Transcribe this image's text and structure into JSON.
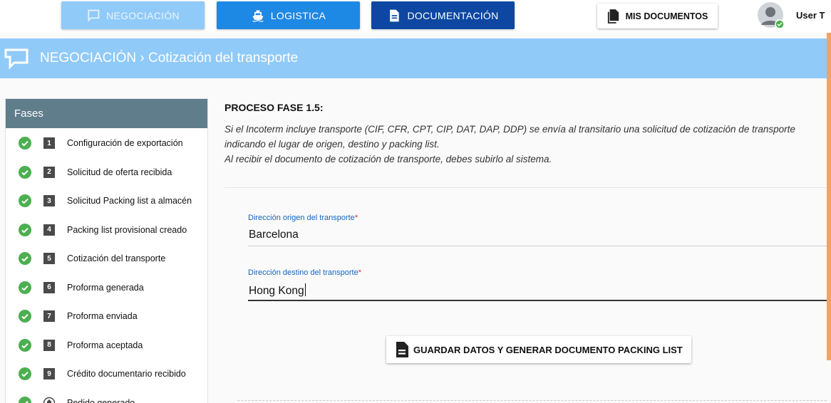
{
  "nav": {
    "negociacion": "NEGOCIACIÓN",
    "logistica": "LOGISTICA",
    "documentacion": "DOCUMENTACIÓN",
    "mis_documentos": "MIS DOCUMENTOS",
    "user": "User T"
  },
  "header": {
    "title": "NEGOCIACIÓN › Cotización del transporte"
  },
  "sidebar": {
    "title": "Fases",
    "phases": [
      {
        "num": "1",
        "label": "Configuración de exportación"
      },
      {
        "num": "2",
        "label": "Solicitud de oferta recibida"
      },
      {
        "num": "3",
        "label": "Solicitud Packing list a almacén"
      },
      {
        "num": "4",
        "label": "Packing list provisional creado"
      },
      {
        "num": "5",
        "label": "Cotización del transporte"
      },
      {
        "num": "6",
        "label": "Proforma generada"
      },
      {
        "num": "7",
        "label": "Proforma enviada"
      },
      {
        "num": "8",
        "label": "Proforma aceptada"
      },
      {
        "num": "9",
        "label": "Crédito documentario recibido"
      },
      {
        "num": "",
        "label": "Pedido generado"
      }
    ]
  },
  "main": {
    "title": "PROCESO FASE 1.5:",
    "desc_line1": "Si el Incoterm incluye transporte (CIF, CFR, CPT, CIP, DAT, DAP, DDP) se envía al transitario una solicitud de cotización de transporte",
    "desc_line2": "indicando el lugar de origen, destino y packing list.",
    "desc_line3": "Al recibir el documento de cotización de transporte, debes subirlo al sistema.",
    "origin_label": "Dirección origen del transporte",
    "origin_value": "Barcelona",
    "dest_label": "Dirección destino del transporte",
    "dest_value": "Hong Kong",
    "required_mark": "*",
    "save_button": "GUARDAR DATOS Y GENERAR DOCUMENTO PACKING LIST"
  },
  "colors": {
    "nav_negociacion": "#90caf9",
    "nav_logistica": "#1e88e5",
    "nav_documentacion": "#0d47a1",
    "header_band": "#90caf9",
    "sidebar_head": "#607d8b",
    "check_green": "#4caf50",
    "label_blue": "#1565c0"
  },
  "icons": {
    "negociacion": "chat-bubble-icon",
    "logistica": "ship-icon",
    "documentacion": "document-icon",
    "mis_documentos": "documents-icon",
    "phase_done": "check-circle-icon",
    "save": "document-icon"
  }
}
